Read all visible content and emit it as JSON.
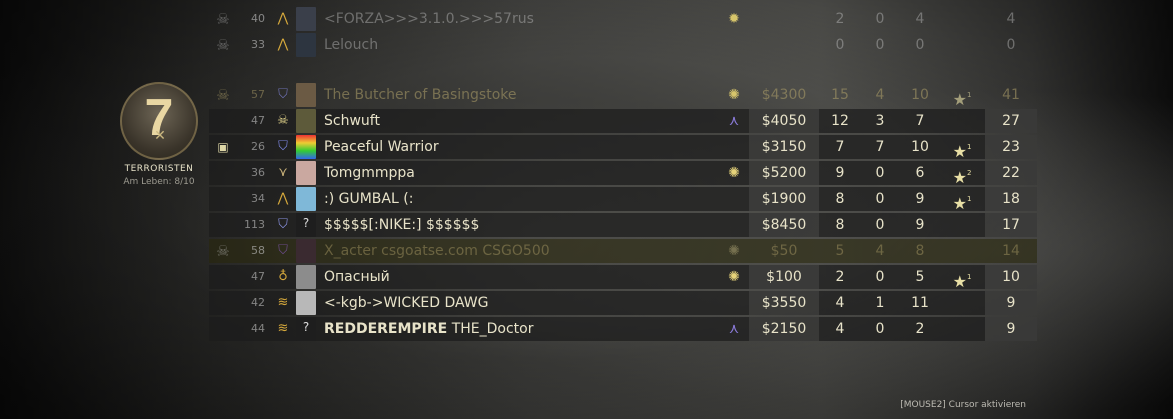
{
  "team": {
    "rounds": "7",
    "name": "TERRORISTEN",
    "alive": "Am Leben: 8/10"
  },
  "hint": "[MOUSE2] Cursor aktivieren",
  "rows": [
    {
      "status": "dead",
      "level": "40",
      "name": "<FORZA>>>3.1.0.>>>57rus",
      "money": "",
      "kills": "2",
      "assists": "0",
      "deaths": "4",
      "mvp": "",
      "mvp_count": "",
      "score": "4"
    },
    {
      "status": "dead",
      "level": "33",
      "name": "Lelouch",
      "money": "",
      "kills": "0",
      "assists": "0",
      "deaths": "0",
      "mvp": "",
      "mvp_count": "",
      "score": "0"
    },
    {
      "status": "t-dead",
      "level": "57",
      "name": "The Butcher of Basingstoke",
      "money": "$4300",
      "kills": "15",
      "assists": "4",
      "deaths": "10",
      "mvp": "★",
      "mvp_count": "1",
      "score": "41"
    },
    {
      "status": "alive",
      "level": "47",
      "name": "Schwuft",
      "money": "$4050",
      "kills": "12",
      "assists": "3",
      "deaths": "7",
      "mvp": "",
      "mvp_count": "",
      "score": "27"
    },
    {
      "status": "alive",
      "level": "26",
      "name": "Peaceful Warrior",
      "money": "$3150",
      "kills": "7",
      "assists": "7",
      "deaths": "10",
      "mvp": "★",
      "mvp_count": "1",
      "score": "23"
    },
    {
      "status": "alive",
      "level": "36",
      "name": "Tomgmmppa",
      "money": "$5200",
      "kills": "9",
      "assists": "0",
      "deaths": "6",
      "mvp": "★",
      "mvp_count": "2",
      "score": "22"
    },
    {
      "status": "alive",
      "level": "34",
      "name": ":) GUMBAL (:",
      "money": "$1900",
      "kills": "8",
      "assists": "0",
      "deaths": "9",
      "mvp": "★",
      "mvp_count": "1",
      "score": "18"
    },
    {
      "status": "alive",
      "level": "113",
      "name": "$$$$$[:NIKE:] $$$$$$",
      "money": "$8450",
      "kills": "8",
      "assists": "0",
      "deaths": "9",
      "mvp": "",
      "mvp_count": "",
      "score": "17"
    },
    {
      "status": "highlight",
      "level": "58",
      "name": "X_acter csgoatse.com CSGO500",
      "money": "$50",
      "kills": "5",
      "assists": "4",
      "deaths": "8",
      "mvp": "",
      "mvp_count": "",
      "score": "14"
    },
    {
      "status": "alive",
      "level": "47",
      "name": "Опасный",
      "money": "$100",
      "kills": "2",
      "assists": "0",
      "deaths": "5",
      "mvp": "★",
      "mvp_count": "1",
      "score": "10"
    },
    {
      "status": "alive",
      "level": "42",
      "name": "<-kgb->WICKED DAWG",
      "money": "$3550",
      "kills": "4",
      "assists": "1",
      "deaths": "11",
      "mvp": "",
      "mvp_count": "",
      "score": "9"
    },
    {
      "status": "alive",
      "level": "44",
      "name_bold": "REDDEREMPIRE",
      "name": " THE_Doctor",
      "money": "$2150",
      "kills": "4",
      "assists": "0",
      "deaths": "2",
      "mvp": "",
      "mvp_count": "",
      "score": "9"
    }
  ],
  "icons": {
    "skull": "skull-icon",
    "star": "mvp-star-icon",
    "bomb": "bomb-carrier-icon",
    "rank": "rank-chevron-icon"
  }
}
